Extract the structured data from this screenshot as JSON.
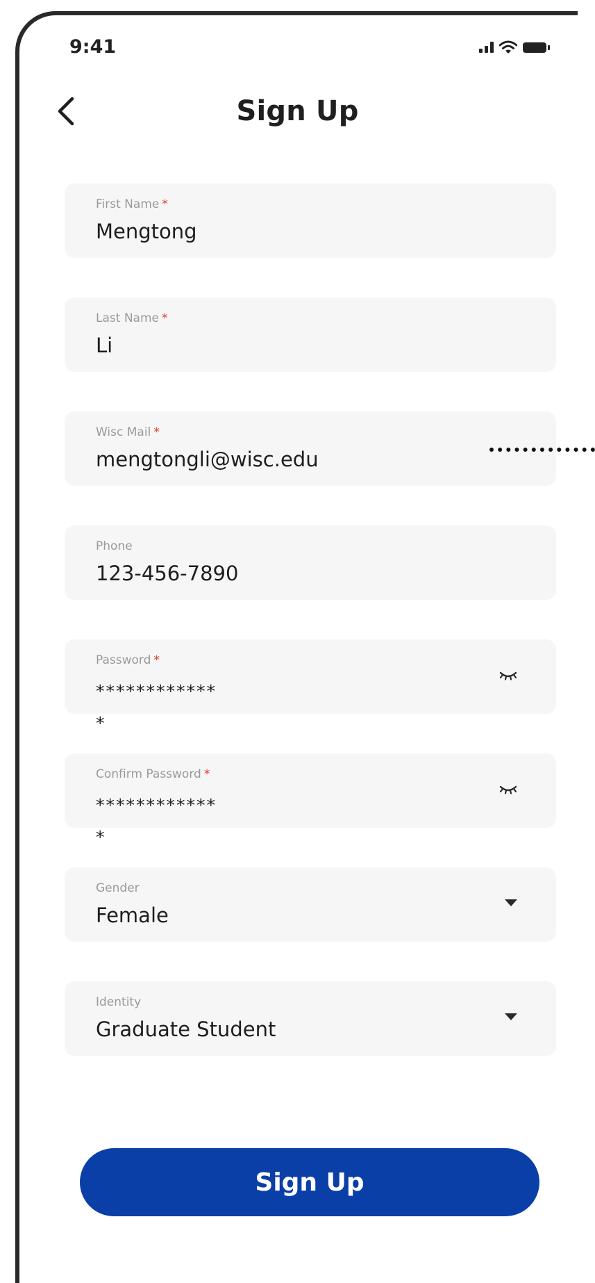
{
  "status_bar": {
    "time": "9:41",
    "icons": [
      "signal-icon",
      "wifi-icon",
      "battery-icon"
    ]
  },
  "header": {
    "title": "Sign Up",
    "back_icon": "chevron-left-icon"
  },
  "form": {
    "required_marker": "*",
    "fields": [
      {
        "label": "First Name",
        "required": true,
        "value": "Mengtong"
      },
      {
        "label": "Last Name",
        "required": true,
        "value": "Li"
      },
      {
        "label": "Wisc Mail",
        "required": true,
        "value": "mengtongli@wisc.edu"
      },
      {
        "label": "Phone",
        "required": false,
        "value": "123-456-7890"
      },
      {
        "label": "Password",
        "required": true,
        "value": "************",
        "overflow": "*",
        "icon": "eye-closed-icon"
      },
      {
        "label": "Confirm Password",
        "required": true,
        "value": "************",
        "overflow": "*",
        "icon": "eye-closed-icon"
      },
      {
        "label": "Gender",
        "required": false,
        "value": "Female",
        "icon": "caret-down-icon"
      },
      {
        "label": "Identity",
        "required": false,
        "value": "Graduate Student",
        "icon": "caret-down-icon"
      }
    ]
  },
  "submit": {
    "label": "Sign Up"
  },
  "colors": {
    "accent": "#0b3fa8",
    "required": "#e23b2e",
    "field_bg": "#f6f6f6",
    "label": "#9a9a9a"
  }
}
